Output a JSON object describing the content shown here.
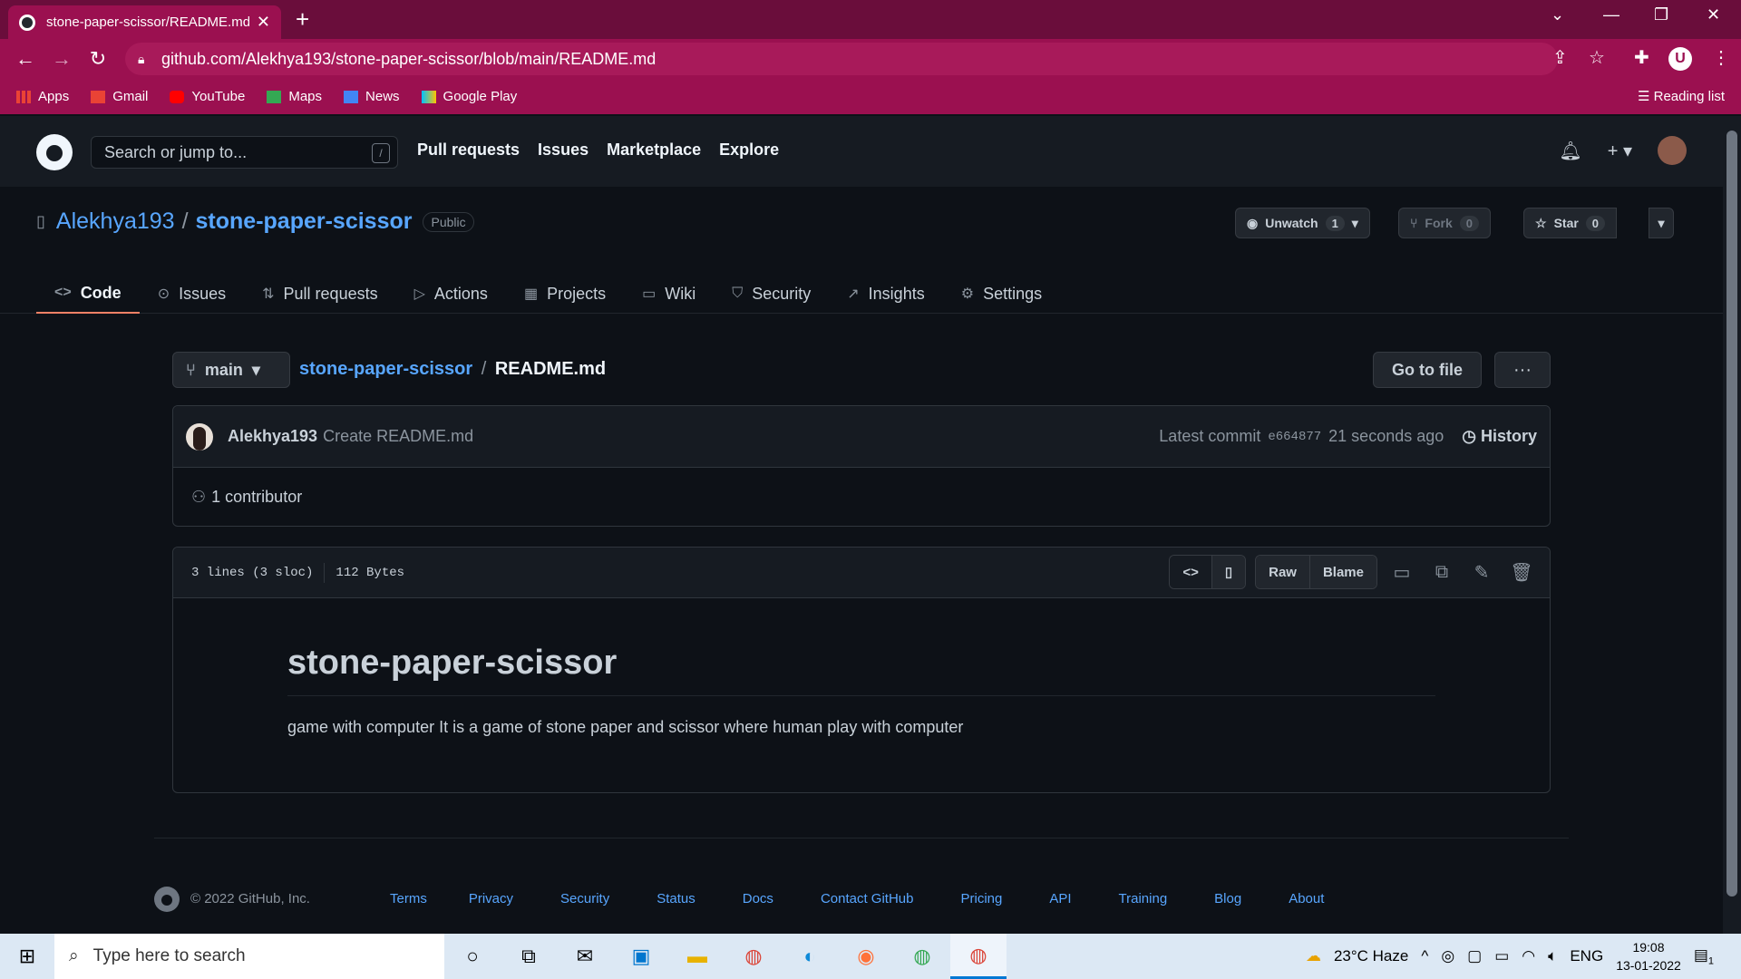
{
  "browser": {
    "tab_title": "stone-paper-scissor/README.md",
    "url": "github.com/Alekhya193/stone-paper-scissor/blob/main/README.md",
    "bookmarks": [
      "Apps",
      "Gmail",
      "YouTube",
      "Maps",
      "News",
      "Google Play"
    ],
    "reading_list": "Reading list",
    "profile_initial": "U"
  },
  "header": {
    "search_placeholder": "Search or jump to...",
    "slash": "/",
    "nav": [
      "Pull requests",
      "Issues",
      "Marketplace",
      "Explore"
    ]
  },
  "repo": {
    "owner": "Alekhya193",
    "sep": "/",
    "name": "stone-paper-scissor",
    "visibility": "Public",
    "unwatch_label": "Unwatch",
    "unwatch_count": "1",
    "fork_label": "Fork",
    "fork_count": "0",
    "star_label": "Star",
    "star_count": "0",
    "tabs": [
      "Code",
      "Issues",
      "Pull requests",
      "Actions",
      "Projects",
      "Wiki",
      "Security",
      "Insights",
      "Settings"
    ]
  },
  "file": {
    "branch": "main",
    "crumb_repo": "stone-paper-scissor",
    "crumb_sep": "/",
    "crumb_file": "README.md",
    "go_to_file": "Go to file",
    "more": "···",
    "commit_user": "Alekhya193",
    "commit_msg": "Create README.md",
    "latest_commit": "Latest commit",
    "sha": "e664877",
    "commit_time": "21 seconds ago",
    "history": "History",
    "contributors": "1 contributor",
    "lines": "3 lines (3 sloc)",
    "size": "112 Bytes",
    "raw": "Raw",
    "blame": "Blame"
  },
  "readme": {
    "heading": "stone-paper-scissor",
    "body": "game with computer It is a game of stone paper and scissor where human play with computer"
  },
  "footer": {
    "copyright": "© 2022 GitHub, Inc.",
    "links": [
      "Terms",
      "Privacy",
      "Security",
      "Status",
      "Docs",
      "Contact GitHub",
      "Pricing",
      "API",
      "Training",
      "Blog",
      "About"
    ]
  },
  "taskbar": {
    "search": "Type here to search",
    "weather": "23°C  Haze",
    "lang": "ENG",
    "time": "19:08",
    "date": "13-01-2022",
    "notif_count": "1"
  }
}
